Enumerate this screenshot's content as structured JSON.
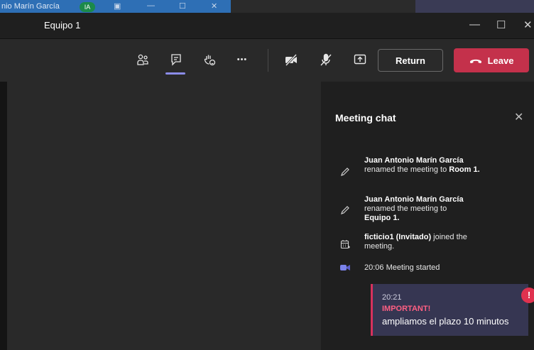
{
  "taskbar": {
    "user_name": "nio Marín García",
    "avatar_initials": "IA",
    "icons": [
      "window-icon",
      "minimize-icon",
      "maximize-icon",
      "close-icon"
    ]
  },
  "titlebar": {
    "title": "Equipo 1",
    "minimize_glyph": "—",
    "maximize_glyph": "☐",
    "close_glyph": "✕"
  },
  "toolbar": {
    "icons": [
      "people-icon",
      "chat-icon",
      "raise-hand-icon",
      "more-icon",
      "camera-off-icon",
      "mic-off-icon",
      "share-screen-icon"
    ],
    "more_glyph": "•••",
    "return_label": "Return",
    "leave_label": "Leave",
    "accent_color": "#8b8ce8",
    "leave_color": "#c4314b"
  },
  "chat": {
    "title": "Meeting chat",
    "close_glyph": "✕",
    "events": [
      {
        "icon": "pencil-icon",
        "actor": "Juan Antonio Marín García",
        "text": " renamed the meeting to ",
        "target": "Room 1."
      },
      {
        "icon": "pencil-icon",
        "actor": "Juan Antonio Marín García",
        "text": " renamed the meeting to ",
        "target": "Equipo 1."
      },
      {
        "icon": "calendar-icon",
        "actor": "ficticio1 (Invitado)",
        "text": " joined the meeting.",
        "target": ""
      },
      {
        "icon": "meeting-camera-icon",
        "actor": "",
        "text": "20:06   Meeting started",
        "target": ""
      }
    ],
    "message": {
      "time": "20:21",
      "importance": "IMPORTANT!",
      "text": "ampliamos el plazo 10 minutos",
      "alert_glyph": "!",
      "alert_color": "#e0324f"
    }
  }
}
